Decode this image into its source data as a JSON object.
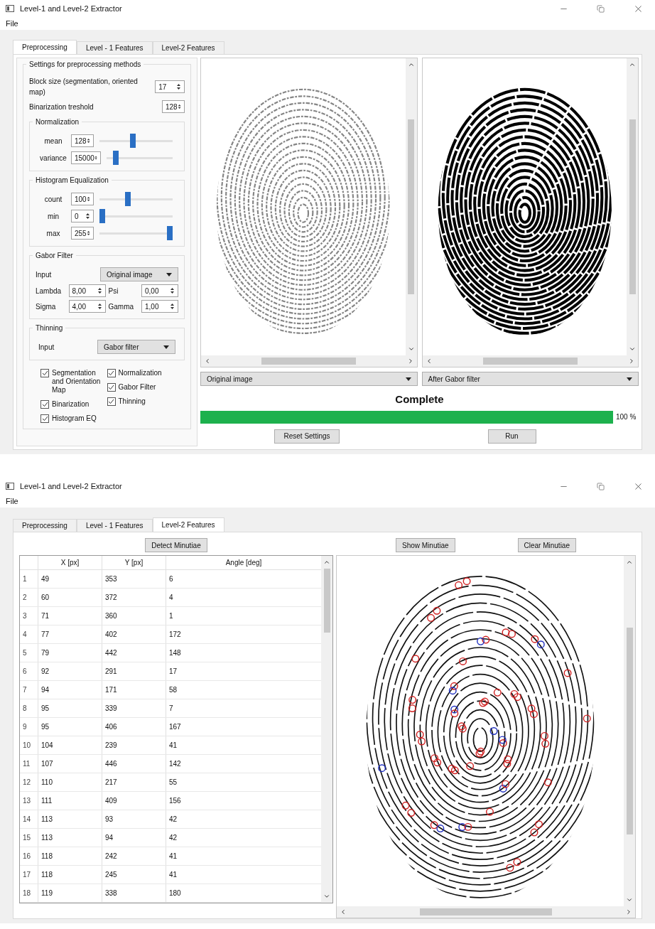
{
  "windows": [
    {
      "kind": "preprocessing",
      "title": "Level-1 and Level-2 Extractor",
      "menu": [
        "File"
      ],
      "tabs": [
        {
          "label": "Preprocessing",
          "selected": true
        },
        {
          "label": "Level - 1 Features",
          "selected": false
        },
        {
          "label": "Level-2 Features",
          "selected": false
        }
      ],
      "settings": {
        "title": "Settings for preprocessing methods",
        "fields": [
          {
            "label": "Block size (segmentation, oriented map)",
            "value": "17"
          },
          {
            "label": "Binarization treshold",
            "value": "128"
          }
        ],
        "groups": [
          {
            "title": "Normalization",
            "rows": [
              {
                "label": "mean",
                "value": "128",
                "level": 0.45
              },
              {
                "label": "variance",
                "value": "15000",
                "level": 0.1
              }
            ]
          },
          {
            "title": "Histogram Equalization",
            "rows": [
              {
                "label": "count",
                "value": "100",
                "level": 0.38
              },
              {
                "label": "min",
                "value": "0",
                "level": 0
              },
              {
                "label": "max",
                "value": "255",
                "level": 1
              }
            ]
          }
        ],
        "gabor": {
          "title": "Gabor Filter",
          "input_label": "Input",
          "input_value": "Original image",
          "params": [
            {
              "label": "Lambda",
              "value": "8,00"
            },
            {
              "label": "Psi",
              "value": "0,00"
            },
            {
              "label": "Sigma",
              "value": "4,00"
            },
            {
              "label": "Gamma",
              "value": "1,00"
            }
          ]
        },
        "thinning": {
          "title": "Thinning",
          "input_label": "Input",
          "input_value": "Gabor filter"
        },
        "checks": [
          [
            {
              "label": "Segmentation and Orientation Map",
              "checked": true
            },
            {
              "label": "Binarization",
              "checked": true
            },
            {
              "label": "Histogram EQ",
              "checked": true
            }
          ],
          [
            {
              "label": "Normalization",
              "checked": true
            },
            {
              "label": "Gabor Filter",
              "checked": true
            },
            {
              "label": "Thinning",
              "checked": true
            }
          ]
        ]
      },
      "views": [
        {
          "kind": "grayscale",
          "selector": "Original image"
        },
        {
          "kind": "binary",
          "selector": "After Gabor filter"
        }
      ],
      "status": "Complete",
      "progress": {
        "level": 1,
        "reading": "100 %"
      },
      "buttons": [
        "Reset Settings",
        "Run"
      ]
    },
    {
      "kind": "minutiae",
      "title": "Level-1 and Level-2 Extractor",
      "menu": [
        "File"
      ],
      "tabs": [
        {
          "label": "Preprocessing",
          "selected": false
        },
        {
          "label": "Level - 1 Features",
          "selected": false
        },
        {
          "label": "Level-2 Features",
          "selected": true
        }
      ],
      "detect_button": "Detect Minutiae",
      "view_buttons": [
        "Show Minutiae",
        "Clear Minutiae"
      ],
      "table": {
        "columns": [
          "X [px]",
          "Y [px]",
          "Angle [deg]"
        ],
        "rows": [
          [
            "1",
            "49",
            "353",
            "6"
          ],
          [
            "2",
            "60",
            "372",
            "4"
          ],
          [
            "3",
            "71",
            "360",
            "1"
          ],
          [
            "4",
            "77",
            "402",
            "172"
          ],
          [
            "5",
            "79",
            "442",
            "148"
          ],
          [
            "6",
            "92",
            "291",
            "17"
          ],
          [
            "7",
            "94",
            "171",
            "58"
          ],
          [
            "8",
            "95",
            "339",
            "7"
          ],
          [
            "9",
            "95",
            "406",
            "167"
          ],
          [
            "10",
            "104",
            "239",
            "41"
          ],
          [
            "11",
            "107",
            "446",
            "142"
          ],
          [
            "12",
            "110",
            "217",
            "55"
          ],
          [
            "13",
            "111",
            "409",
            "156"
          ],
          [
            "14",
            "113",
            "93",
            "42"
          ],
          [
            "15",
            "113",
            "94",
            "42"
          ],
          [
            "16",
            "118",
            "242",
            "41"
          ],
          [
            "17",
            "118",
            "245",
            "41"
          ],
          [
            "18",
            "119",
            "338",
            "180"
          ]
        ]
      }
    }
  ]
}
